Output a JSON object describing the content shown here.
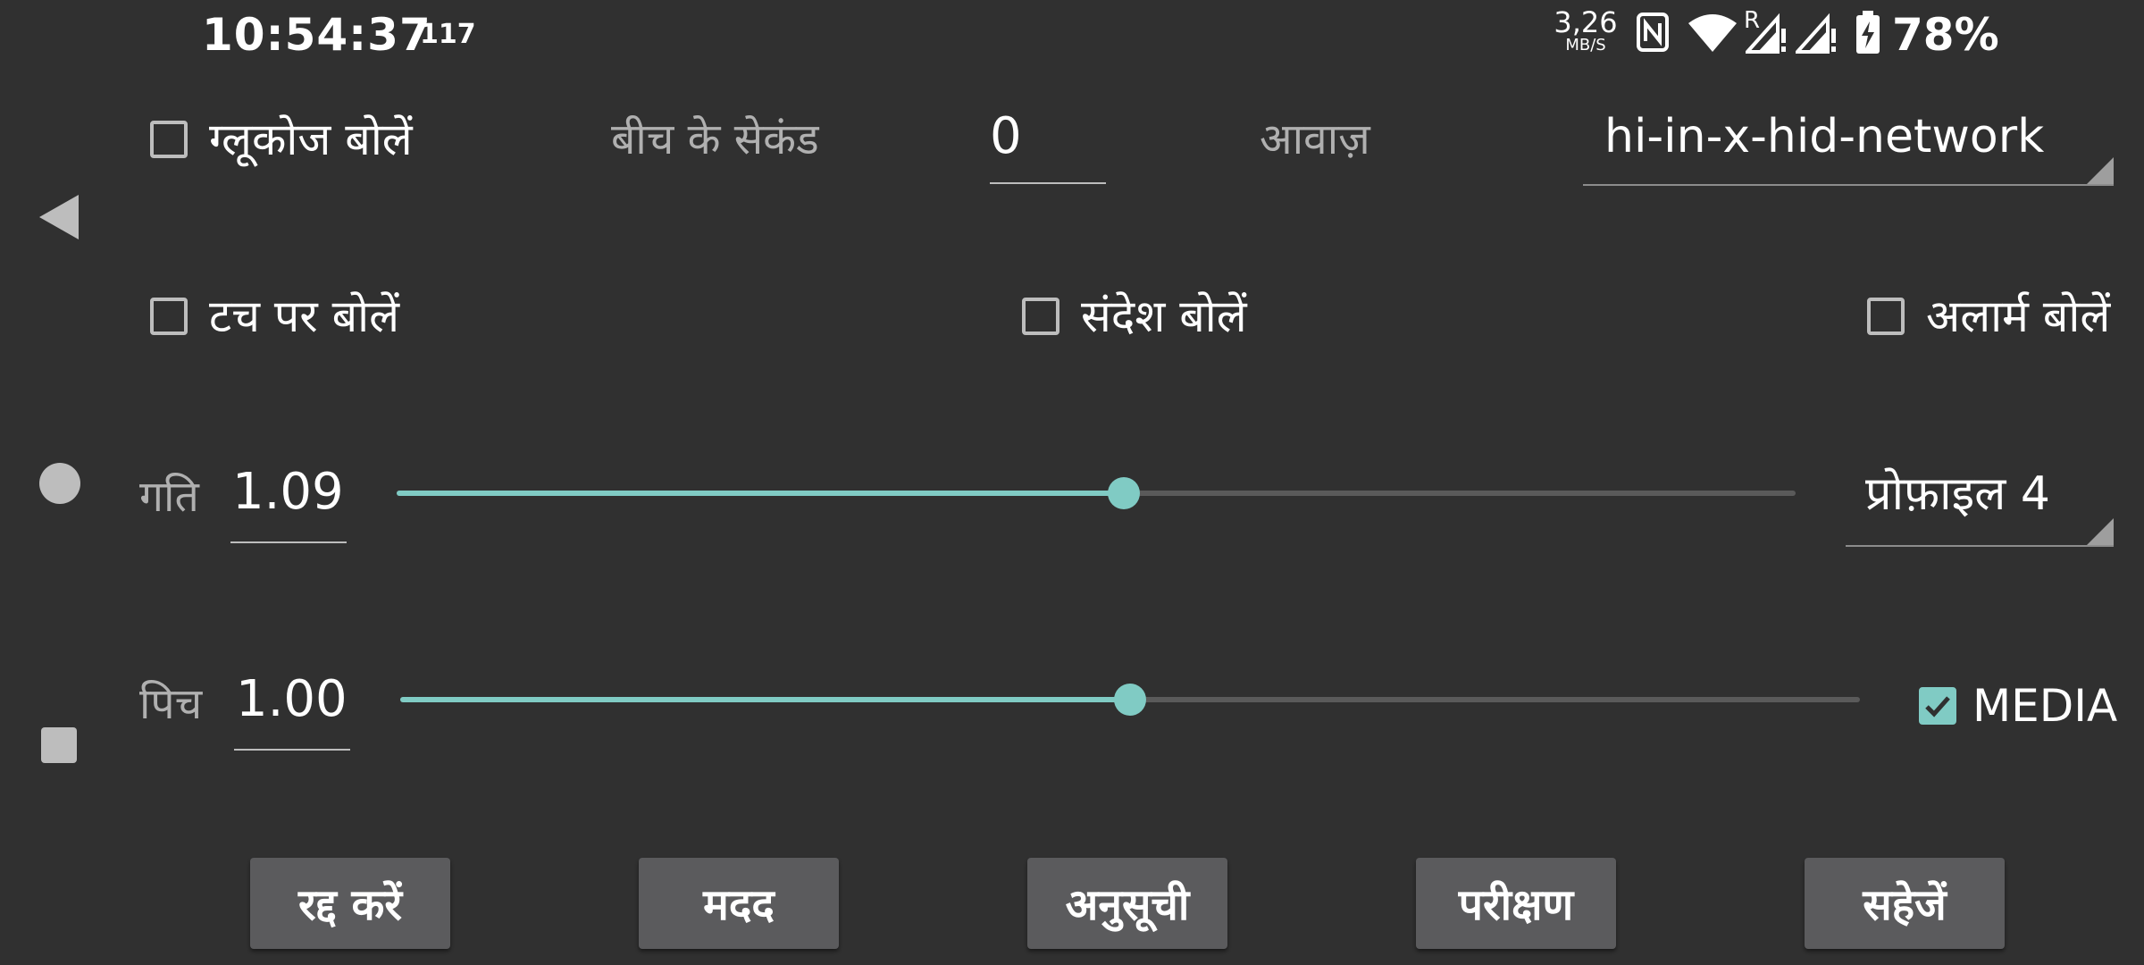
{
  "status_bar": {
    "time": "10:54:37",
    "notification_count": "117",
    "net_speed_value": "3,26",
    "net_speed_unit": "MB/S",
    "battery": "78%"
  },
  "settings": {
    "speak_glucose_label": "ग्लूकोज बोलें",
    "interval_label": "बीच के सेकंड",
    "interval_value": "0",
    "voice_label": "आवाज़",
    "voice_value": "hi-in-x-hid-network",
    "speak_on_touch_label": "टच पर बोलें",
    "speak_messages_label": "संदेश बोलें",
    "speak_alarms_label": "अलार्म बोलें",
    "speed_label": "गति",
    "speed_value": "1.09",
    "speed_slider_fraction": 0.52,
    "profile_value": "प्रोफ़ाइल 4",
    "pitch_label": "पिच",
    "pitch_value": "1.00",
    "pitch_slider_fraction": 0.5,
    "media_label": "MEDIA",
    "media_checked": true
  },
  "buttons": {
    "cancel": "रद्द करें",
    "help": "मदद",
    "schedule": "अनुसूची",
    "test": "परीक्षण",
    "save": "सहेजें"
  },
  "colors": {
    "background": "#303030",
    "accent": "#80cbc4",
    "button_bg": "#5b5b5d"
  }
}
